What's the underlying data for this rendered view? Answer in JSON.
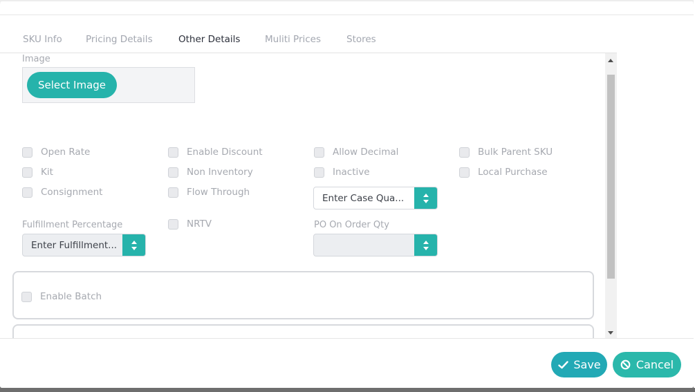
{
  "tabs": [
    {
      "label": "SKU Info",
      "active": false
    },
    {
      "label": "Pricing Details",
      "active": false
    },
    {
      "label": "Other Details",
      "active": true
    },
    {
      "label": "Muliti Prices",
      "active": false
    },
    {
      "label": "Stores",
      "active": false
    }
  ],
  "image_section": {
    "label": "Image",
    "select_button": "Select Image"
  },
  "checkboxes": {
    "open_rate": "Open Rate",
    "enable_discount": "Enable Discount",
    "allow_decimal": "Allow Decimal",
    "bulk_parent_sku": "Bulk Parent SKU",
    "kit": "Kit",
    "non_inventory": "Non Inventory",
    "inactive": "Inactive",
    "local_purchase": "Local Purchase",
    "consignment": "Consignment",
    "flow_through": "Flow Through",
    "nrtv": "NRTV",
    "enable_batch": "Enable Batch"
  },
  "fields": {
    "case_quantity": {
      "placeholder": "Enter Case Qua..."
    },
    "fulfillment_percentage": {
      "label": "Fulfillment Percentage",
      "placeholder": "Enter Fulfillment..."
    },
    "po_on_order_qty": {
      "label": "PO On Order Qty",
      "value": ""
    }
  },
  "footer": {
    "save_label": "Save",
    "cancel_label": "Cancel"
  },
  "icons": {
    "save": "check-icon",
    "cancel": "ban-icon"
  },
  "colors": {
    "accent": "#26b3ab",
    "save_button": "#22a9b5",
    "active_tab": "#2b2f3a",
    "inactive_tab": "#a3a7b0"
  }
}
